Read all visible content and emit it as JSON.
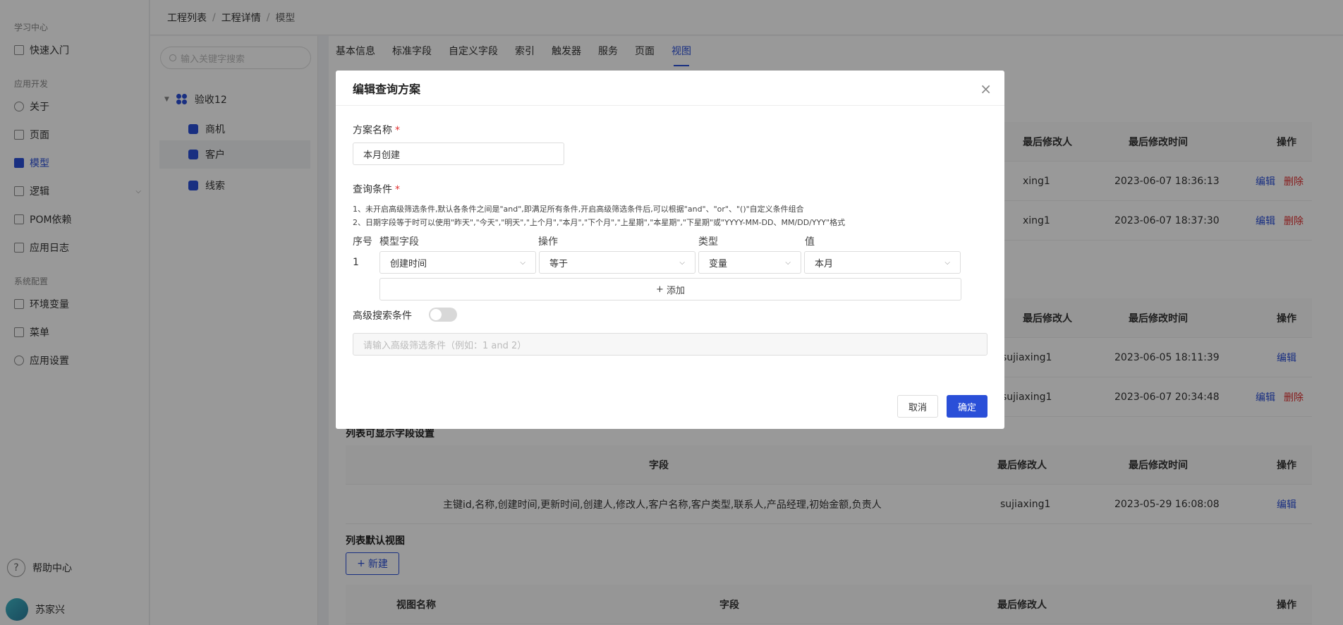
{
  "sidebar": {
    "groups": [
      "学习中心",
      "应用开发",
      "系统配置"
    ],
    "items": [
      {
        "label": "快速入门",
        "icon": "book-icon"
      },
      {
        "label": "关于",
        "icon": "clock-icon"
      },
      {
        "label": "页面",
        "icon": "page-icon"
      },
      {
        "label": "模型",
        "icon": "cube-icon"
      },
      {
        "label": "逻辑",
        "icon": "flow-icon"
      },
      {
        "label": "POM依赖",
        "icon": "m-icon"
      },
      {
        "label": "应用日志",
        "icon": "log-icon"
      },
      {
        "label": "环境变量",
        "icon": "env-icon"
      },
      {
        "label": "菜单",
        "icon": "menu-icon"
      },
      {
        "label": "应用设置",
        "icon": "gear-icon"
      }
    ],
    "help": "帮助中心",
    "help_glyph": "?",
    "user": "苏家兴"
  },
  "breadcrumb": [
    "工程列表",
    "工程详情",
    "模型"
  ],
  "breadcrumb_sep": "/",
  "tree": {
    "search_placeholder": "输入关键字搜索",
    "root": "验收12",
    "children": [
      "商机",
      "客户",
      "线索"
    ]
  },
  "tabs": [
    "基本信息",
    "标准字段",
    "自定义字段",
    "索引",
    "触发器",
    "服务",
    "页面",
    "视图"
  ],
  "table1": {
    "headers": [
      "最后修改人",
      "最后修改时间",
      "操作"
    ],
    "rows": [
      {
        "modifier": "xing1",
        "time": "2023-06-07 18:36:13",
        "edit": "编辑",
        "delete": "删除"
      },
      {
        "modifier": "xing1",
        "time": "2023-06-07 18:37:30",
        "edit": "编辑",
        "delete": "删除"
      }
    ]
  },
  "table2": {
    "headers": [
      "最后修改人",
      "最后修改时间",
      "操作"
    ],
    "rows": [
      {
        "modifier": "sujiaxing1",
        "time": "2023-06-05 18:11:39",
        "edit": "编辑",
        "delete": ""
      },
      {
        "modifier": "sujiaxing1",
        "time": "2023-06-07 20:34:48",
        "edit": "编辑",
        "delete": "删除"
      }
    ]
  },
  "section3": {
    "title": "列表可显示字段设置",
    "headers": [
      "字段",
      "最后修改人",
      "最后修改时间",
      "操作"
    ],
    "row": {
      "fields": "主键id,名称,创建时间,更新时间,创建人,修改人,客户名称,客户类型,联系人,产品经理,初始金额,负责人",
      "modifier": "sujiaxing1",
      "time": "2023-05-29 16:08:08",
      "edit": "编辑"
    }
  },
  "section4": {
    "title": "列表默认视图",
    "new_label": "新建",
    "plus_glyph": "+",
    "headers": [
      "视图名称",
      "字段",
      "最后修改人",
      "操作"
    ]
  },
  "modal": {
    "title": "编辑查询方案",
    "close_glyph": "×",
    "name_label": "方案名称",
    "required_mark": "*",
    "name_value": "本月创建",
    "cond_label": "查询条件",
    "note1": "1、未开启高级筛选条件,默认各条件之间是\"and\",即满足所有条件,开启高级筛选条件后,可以根据\"and\"、\"or\"、\"()\"自定义条件组合",
    "note2": "2、日期字段等于时可以使用\"昨天\",\"今天\",\"明天\",\"上个月\",\"本月\",\"下个月\",\"上星期\",\"本星期\",\"下星期\"或\"YYYY-MM-DD、MM/DD/YYY\"格式",
    "col_headers": [
      "序号",
      "模型字段",
      "操作",
      "类型",
      "值"
    ],
    "row": {
      "index": "1",
      "field": "创建时间",
      "op": "等于",
      "type": "变量",
      "value": "本月"
    },
    "chevron_glyph": "⌵",
    "add_label": "添加",
    "add_glyph": "+",
    "advanced_label": "高级搜索条件",
    "advanced_placeholder": "请输入高级筛选条件（例如：1 and 2）",
    "cancel_label": "取消",
    "ok_label": "确定"
  },
  "colors": {
    "accent": "#2a4fd8",
    "danger": "#e03030"
  }
}
